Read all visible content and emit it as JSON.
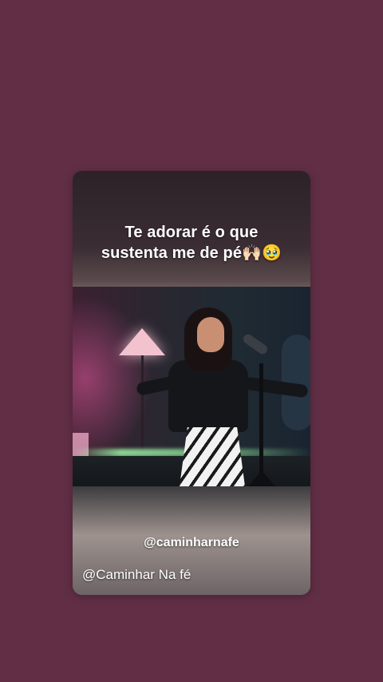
{
  "story": {
    "caption": "Te adorar é o que sustenta me de pé🙌🏻🥹",
    "video": {
      "scene": "singer-on-stage"
    },
    "handle": "@caminharnafe",
    "watermark": "@Caminhar Na fé"
  },
  "colors": {
    "background": "#612e45",
    "text": "#ffffff"
  }
}
